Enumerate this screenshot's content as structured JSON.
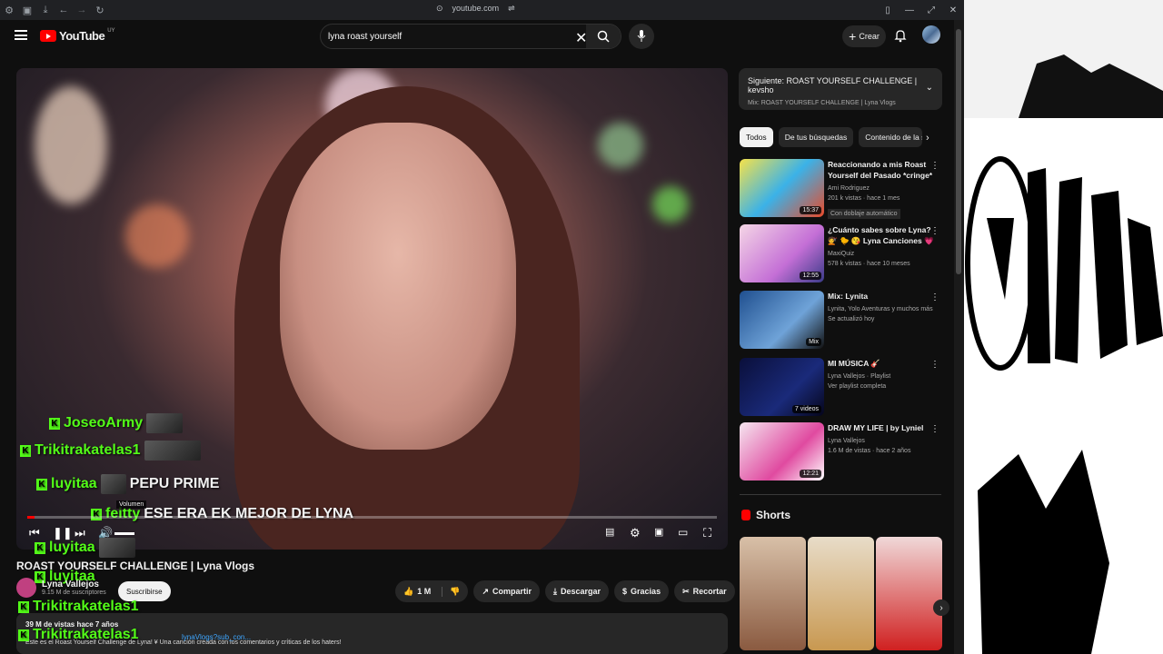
{
  "browser": {
    "url": "youtube.com"
  },
  "header": {
    "logo": "YouTube",
    "logo_country": "UY",
    "search_value": "lyna roast yourself",
    "create_label": "Crear"
  },
  "video": {
    "chat": [
      {
        "user": "JoseoArmy",
        "msg": ""
      },
      {
        "user": "Trikitrakatelas1",
        "msg": ""
      },
      {
        "user": "luyitaa",
        "msg": "PEPU PRIME"
      },
      {
        "user": "feitty",
        "msg": "ESE ERA EK MEJOR DE LYNA"
      },
      {
        "user": "luyitaa",
        "msg": ""
      },
      {
        "user": "luyitaa",
        "msg": ""
      },
      {
        "user": "Trikitrakatelas1",
        "msg": ""
      },
      {
        "user": "Trikitrakatelas1",
        "msg": ""
      }
    ],
    "volume_tooltip": "Volumen",
    "progress_fraction": 0.01,
    "title": "ROAST YOURSELF CHALLENGE | Lyna Vlogs",
    "channel": "Lyna Vallejos",
    "subscribers": "9.15 M de suscriptores",
    "subscribe_label": "Suscribirse",
    "actions": {
      "likes": "1 M",
      "share": "Compartir",
      "download": "Descargar",
      "thanks": "Gracias",
      "clip": "Recortar"
    },
    "desc_meta": "39 M de vistas  hace 7 años",
    "desc_link": "lynaVlogs?sub_con...",
    "desc_text": "Este es el Roast Yourself Challenge de Lyna! ¥ Una canción creada con los comentarios y críticas de los haters!"
  },
  "sidebar": {
    "next_title": "Siguiente: ROAST YOURSELF CHALLENGE | kevsho",
    "next_sub": "Mix: ROAST YOURSELF CHALLENGE | Lyna Vlogs",
    "chips": [
      "Todos",
      "De tus búsquedas",
      "Contenido de la ser"
    ],
    "recs": [
      {
        "title": "Reaccionando a mis Roast Yourself del Pasado *cringe* - ...",
        "channel": "Ami Rodriguez",
        "meta": "201 k vistas · hace 1 mes",
        "extra": "Con doblaje automático",
        "duration": "15:37"
      },
      {
        "title": "¿Cuánto sabes sobre Lyna? 💇 🐤 😘 Lyna Canciones 💗 Lyn...",
        "channel": "MaxiQuiz",
        "meta": "578 k vistas · hace 10 meses",
        "extra": "",
        "duration": "12:55"
      },
      {
        "title": "Mix: Lynita",
        "channel": "Lynita, Yolo Aventuras y muchos más",
        "meta": "Se actualizó hoy",
        "extra": "",
        "duration": "Mix"
      },
      {
        "title": "MI MÚSICA 🎸",
        "channel": "Lyna Vallejos · Playlist",
        "meta": "Ver playlist completa",
        "extra": "",
        "duration": "7 videos"
      },
      {
        "title": "DRAW MY LIFE | by Lyniel",
        "channel": "Lyna Vallejos",
        "meta": "1.6 M de vistas · hace 2 años",
        "extra": "",
        "duration": "12:21"
      }
    ],
    "shorts_label": "Shorts"
  }
}
